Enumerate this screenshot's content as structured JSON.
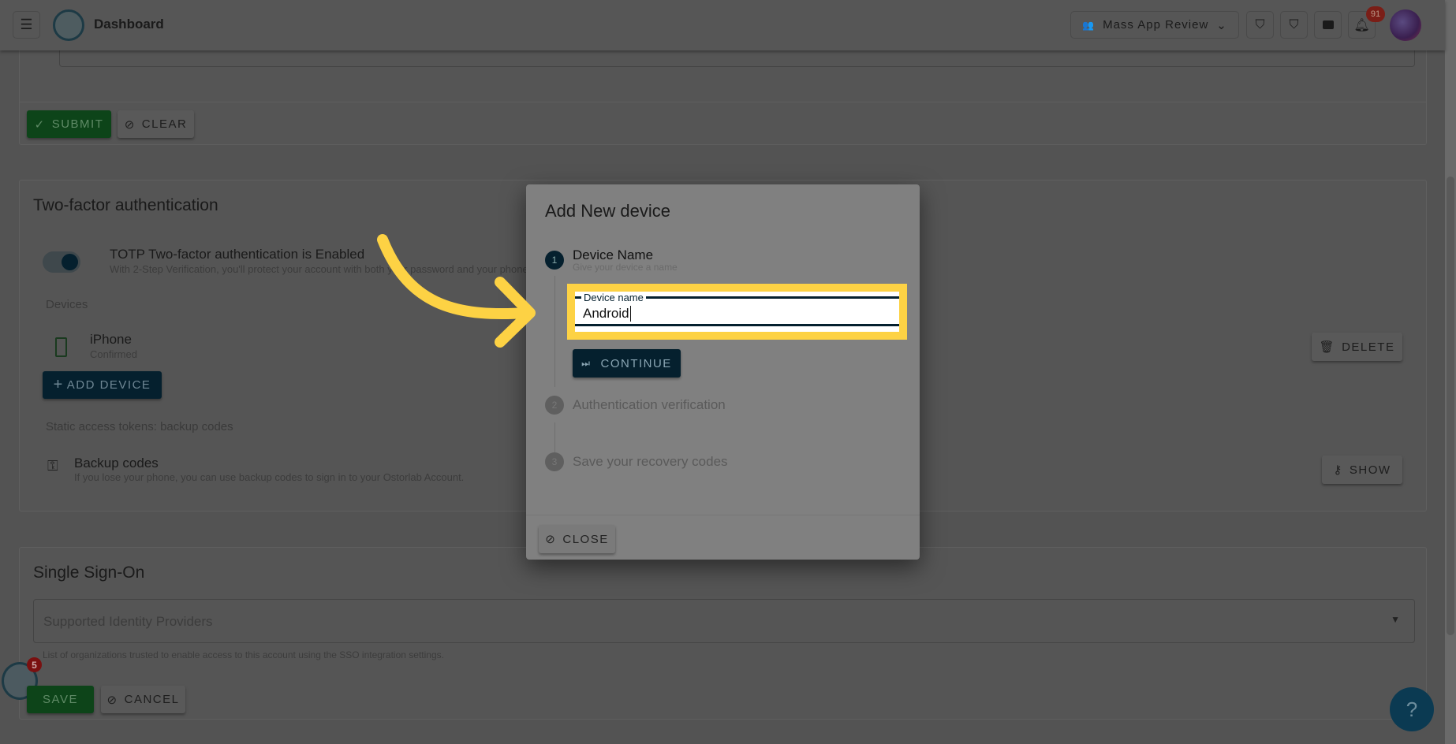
{
  "header": {
    "title": "Dashboard",
    "team": "Mass App Review",
    "notification_count": "91"
  },
  "top_card": {
    "submit": "SUBMIT",
    "clear": "CLEAR"
  },
  "two_factor": {
    "title": "Two-factor authentication",
    "totp_title": "TOTP Two-factor authentication is Enabled",
    "totp_sub": "With 2-Step Verification, you'll protect your account with both your password and your phone",
    "totp_enabled": true,
    "devices_label": "Devices",
    "devices": [
      {
        "name": "iPhone",
        "status": "Confirmed",
        "delete": "DELETE"
      }
    ],
    "add_device": "ADD DEVICE",
    "static_label": "Static access tokens: backup codes",
    "backup_title": "Backup codes",
    "backup_sub": "If you lose your phone, you can use backup codes to sign in to your Ostorlab Account.",
    "show": "SHOW"
  },
  "sso": {
    "title": "Single Sign-On",
    "select_placeholder": "Supported Identity Providers",
    "helper": "List of organizations trusted to enable access to this account using the SSO integration settings.",
    "save": "SAVE",
    "cancel": "CANCEL"
  },
  "widget": {
    "badge": "5"
  },
  "help": {
    "label": "?"
  },
  "dialog": {
    "title": "Add New device",
    "steps": [
      {
        "num": "1",
        "label": "Device Name",
        "sub": "Give your device a name"
      },
      {
        "num": "2",
        "label": "Authentication verification"
      },
      {
        "num": "3",
        "label": "Save your recovery codes"
      }
    ],
    "field_label": "Device name",
    "field_value": "Android",
    "continue": "CONTINUE",
    "close": "CLOSE"
  },
  "colors": {
    "highlight": "#fdd244",
    "navy": "#05202e",
    "green": "#0d4419",
    "badge": "#b3261e"
  }
}
